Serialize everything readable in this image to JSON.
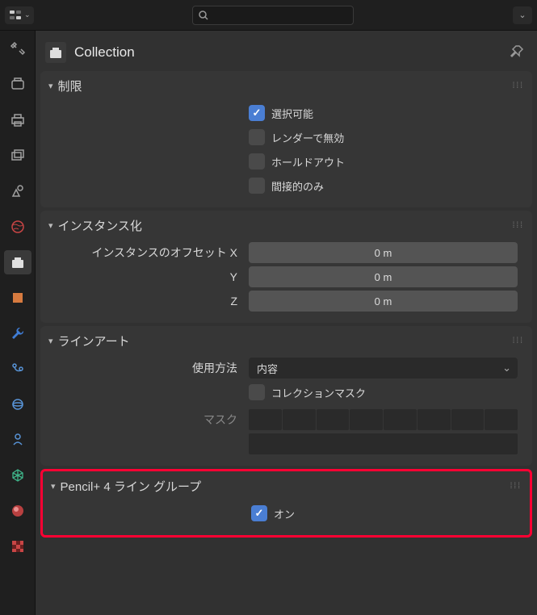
{
  "header": {
    "title": "Collection"
  },
  "panels": {
    "restriction": {
      "title": "制限",
      "selectable": {
        "label": "選択可能",
        "checked": true
      },
      "render_disabled": {
        "label": "レンダーで無効",
        "checked": false
      },
      "holdout": {
        "label": "ホールドアウト",
        "checked": false
      },
      "indirect_only": {
        "label": "間接的のみ",
        "checked": false
      }
    },
    "instancing": {
      "title": "インスタンス化",
      "offset_label": "インスタンスのオフセット X",
      "y_label": "Y",
      "z_label": "Z",
      "x": "0 m",
      "y": "0 m",
      "z": "0 m"
    },
    "lineart": {
      "title": "ラインアート",
      "usage_label": "使用方法",
      "usage_value": "内容",
      "collection_mask": {
        "label": "コレクションマスク",
        "checked": false
      },
      "mask_label": "マスク"
    },
    "pencil": {
      "title": "Pencil+ 4 ライン グループ",
      "on": {
        "label": "オン",
        "checked": true
      }
    }
  }
}
